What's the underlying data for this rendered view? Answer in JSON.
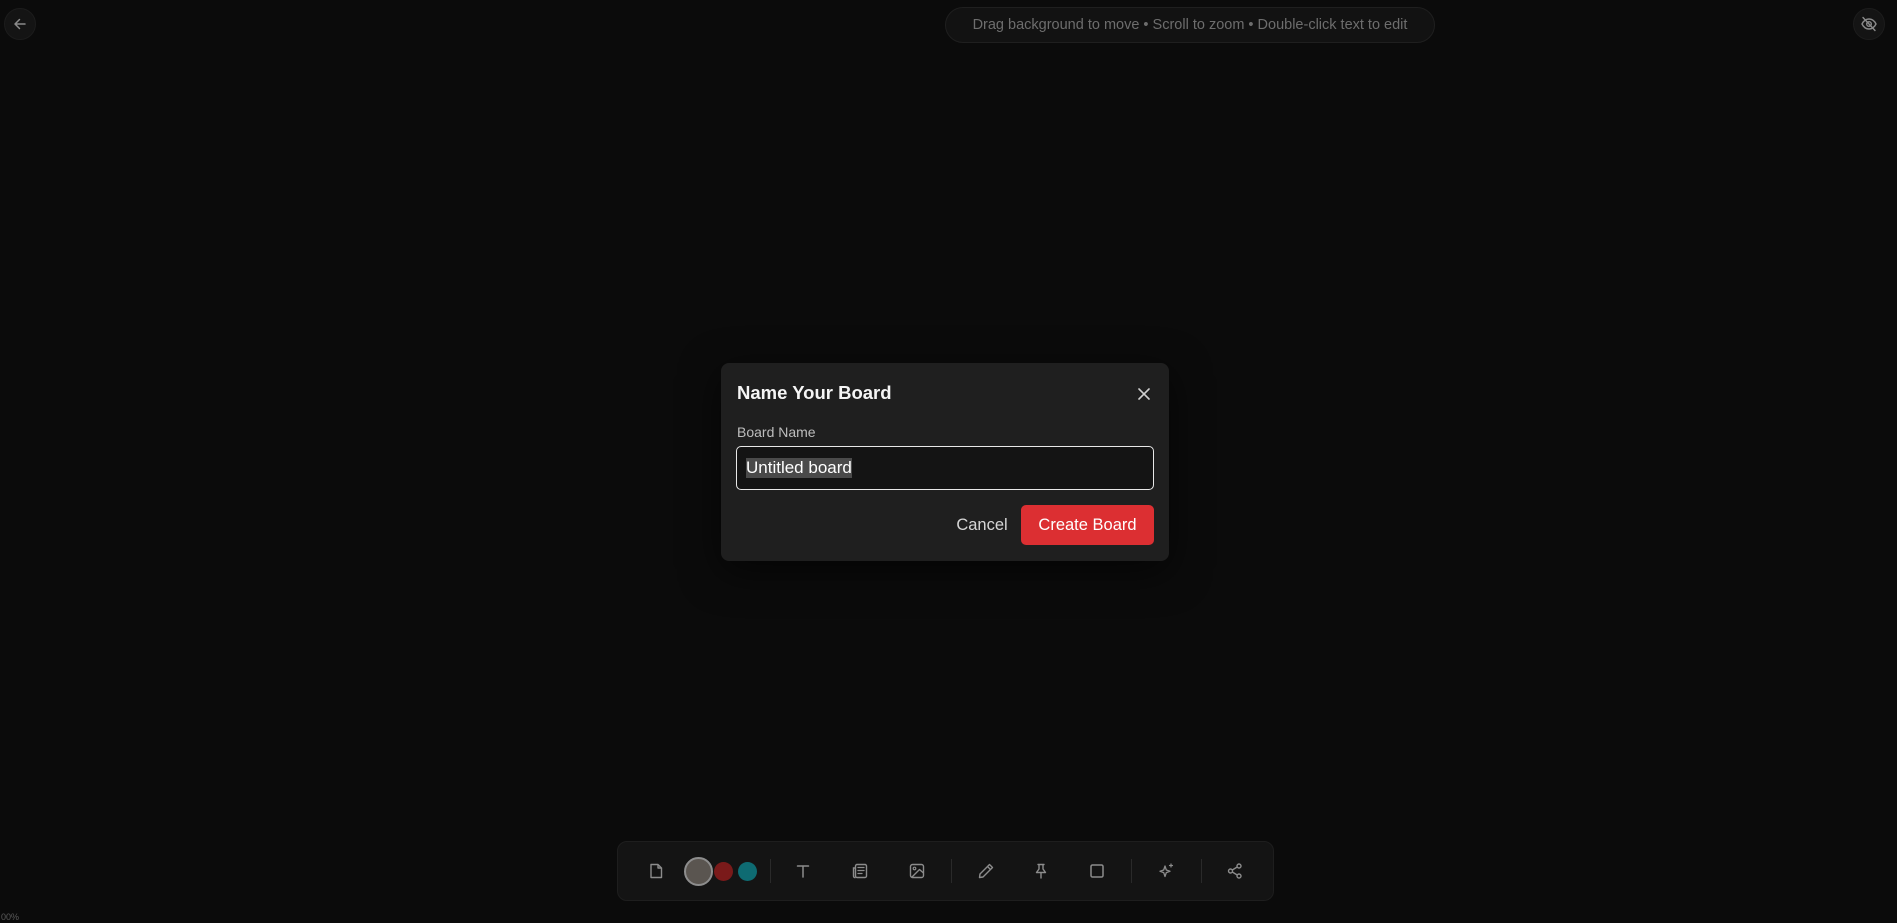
{
  "header": {
    "hint": "Drag background to move • Scroll to zoom • Double-click text to edit",
    "back_icon": "arrow-left-icon",
    "visibility_icon": "eye-off-icon"
  },
  "dialog": {
    "title": "Name Your Board",
    "field_label": "Board Name",
    "input_value": "Untitled board",
    "cancel_label": "Cancel",
    "create_label": "Create Board",
    "close_icon": "close-icon"
  },
  "toolbar": {
    "tools": [
      {
        "name": "note",
        "icon": "sticky-note-icon"
      },
      {
        "name": "text",
        "icon": "text-icon"
      },
      {
        "name": "document",
        "icon": "newspaper-icon"
      },
      {
        "name": "image",
        "icon": "image-icon"
      },
      {
        "name": "pen",
        "icon": "pencil-icon"
      },
      {
        "name": "pin",
        "icon": "pin-icon"
      },
      {
        "name": "shape",
        "icon": "square-icon"
      },
      {
        "name": "ai",
        "icon": "sparkles-icon"
      },
      {
        "name": "share",
        "icon": "share-icon"
      }
    ],
    "swatches": [
      {
        "name": "gray",
        "color": "#5a5550"
      },
      {
        "name": "red",
        "color": "#7a1a1a"
      },
      {
        "name": "teal",
        "color": "#0e6b72"
      }
    ]
  },
  "zoom": {
    "label": "00%"
  },
  "colors": {
    "accent": "#dc2f32",
    "background": "#0b0b0b",
    "dialog": "#1f1f1f"
  }
}
